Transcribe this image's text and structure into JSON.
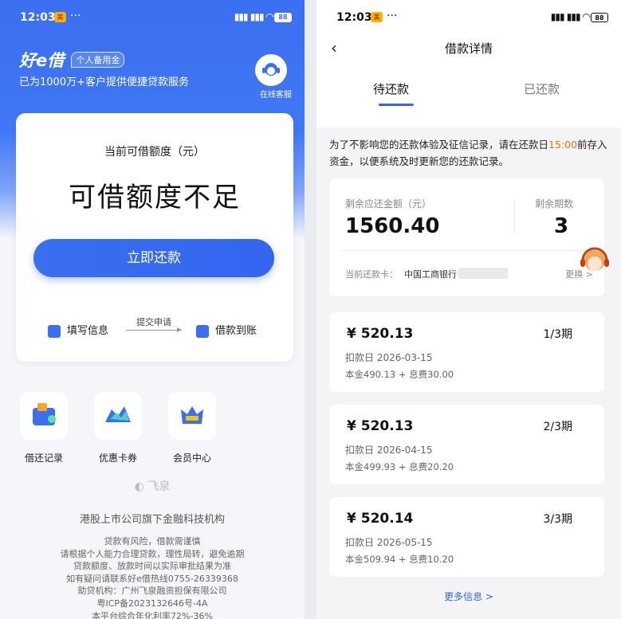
{
  "left": {
    "status": {
      "time": "12:03",
      "badge": "美",
      "dots": "···",
      "battery": "88"
    },
    "brand": {
      "logo": "好e借",
      "tag": "个人备用金",
      "slogan": "已为1000万+客户提供便捷贷款服务"
    },
    "service_label": "在线客服",
    "quota": {
      "label": "当前可借额度（元）",
      "value": "可借额度不足"
    },
    "repay_button": "立即还款",
    "steps": {
      "step1": "填写信息",
      "middle": "提交申请",
      "step2": "借款到账"
    },
    "features": [
      {
        "label": "借还记录",
        "icon": "wallet-icon"
      },
      {
        "label": "优惠卡券",
        "icon": "coupon-icon"
      },
      {
        "label": "会员中心",
        "icon": "crown-icon"
      }
    ],
    "partner": "飞泉",
    "listed": "港股上市公司旗下金融科技机构",
    "disclaimer": [
      "贷款有风险，借款需谨慎",
      "请根据个人能力合理贷款，理性局转，避免逾期",
      "贷款额度、放款时间以实际审批结果为准",
      "如有疑问请联系好e借热线0755-26339368",
      "助贷机构：广州飞泉融资担保有限公司",
      "粤ICP备2023132646号-4A",
      "本平台综合年化利率72%-36%"
    ]
  },
  "right": {
    "status": {
      "time": "12:03",
      "badge": "美",
      "dots": "···",
      "battery": "88"
    },
    "nav_title": "借款详情",
    "tabs": {
      "active": "待还款",
      "other": "已还款"
    },
    "notice": {
      "pre": "为了不影响您的还款体验及征信记录，请在还款日",
      "time": "15:00",
      "post": "前存入资金，以便系统及时更新您的还款记录。"
    },
    "summary": {
      "remaining_label": "剩余应还金额（元）",
      "remaining_value": "1560.40",
      "periods_label": "剩余期数",
      "periods_value": "3",
      "card_label": "当前还款卡：",
      "card_name": "中国工商银行",
      "change": "更换 >"
    },
    "plans": [
      {
        "amount": "¥ 520.13",
        "period": "1/3期",
        "date": "扣款日 2026-03-15",
        "detail": "本金490.13 + 息费30.00"
      },
      {
        "amount": "¥ 520.13",
        "period": "2/3期",
        "date": "扣款日 2026-04-15",
        "detail": "本金499.93 + 息费20.20"
      },
      {
        "amount": "¥ 520.14",
        "period": "3/3期",
        "date": "扣款日 2026-05-15",
        "detail": "本金509.94 + 息费10.20"
      }
    ],
    "more": "更多信息 >"
  },
  "colors": {
    "primary": "#3366ee",
    "highlight": "#e8740d"
  }
}
